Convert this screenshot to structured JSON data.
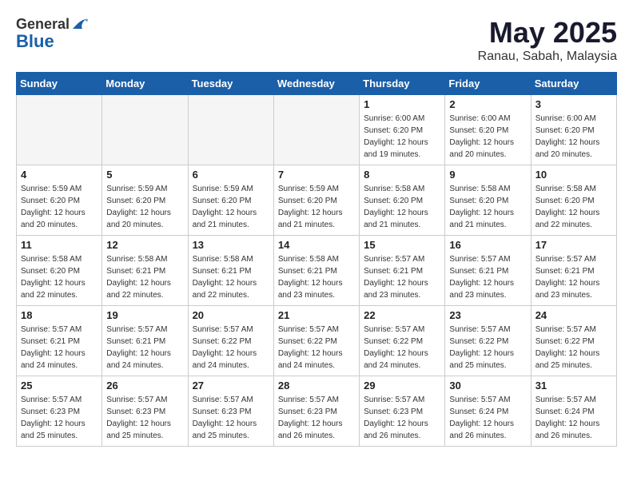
{
  "logo": {
    "general": "General",
    "blue": "Blue"
  },
  "header": {
    "month": "May 2025",
    "location": "Ranau, Sabah, Malaysia"
  },
  "weekdays": [
    "Sunday",
    "Monday",
    "Tuesday",
    "Wednesday",
    "Thursday",
    "Friday",
    "Saturday"
  ],
  "weeks": [
    [
      {
        "day": "",
        "info": ""
      },
      {
        "day": "",
        "info": ""
      },
      {
        "day": "",
        "info": ""
      },
      {
        "day": "",
        "info": ""
      },
      {
        "day": "1",
        "info": "Sunrise: 6:00 AM\nSunset: 6:20 PM\nDaylight: 12 hours\nand 19 minutes."
      },
      {
        "day": "2",
        "info": "Sunrise: 6:00 AM\nSunset: 6:20 PM\nDaylight: 12 hours\nand 20 minutes."
      },
      {
        "day": "3",
        "info": "Sunrise: 6:00 AM\nSunset: 6:20 PM\nDaylight: 12 hours\nand 20 minutes."
      }
    ],
    [
      {
        "day": "4",
        "info": "Sunrise: 5:59 AM\nSunset: 6:20 PM\nDaylight: 12 hours\nand 20 minutes."
      },
      {
        "day": "5",
        "info": "Sunrise: 5:59 AM\nSunset: 6:20 PM\nDaylight: 12 hours\nand 20 minutes."
      },
      {
        "day": "6",
        "info": "Sunrise: 5:59 AM\nSunset: 6:20 PM\nDaylight: 12 hours\nand 21 minutes."
      },
      {
        "day": "7",
        "info": "Sunrise: 5:59 AM\nSunset: 6:20 PM\nDaylight: 12 hours\nand 21 minutes."
      },
      {
        "day": "8",
        "info": "Sunrise: 5:58 AM\nSunset: 6:20 PM\nDaylight: 12 hours\nand 21 minutes."
      },
      {
        "day": "9",
        "info": "Sunrise: 5:58 AM\nSunset: 6:20 PM\nDaylight: 12 hours\nand 21 minutes."
      },
      {
        "day": "10",
        "info": "Sunrise: 5:58 AM\nSunset: 6:20 PM\nDaylight: 12 hours\nand 22 minutes."
      }
    ],
    [
      {
        "day": "11",
        "info": "Sunrise: 5:58 AM\nSunset: 6:20 PM\nDaylight: 12 hours\nand 22 minutes."
      },
      {
        "day": "12",
        "info": "Sunrise: 5:58 AM\nSunset: 6:21 PM\nDaylight: 12 hours\nand 22 minutes."
      },
      {
        "day": "13",
        "info": "Sunrise: 5:58 AM\nSunset: 6:21 PM\nDaylight: 12 hours\nand 22 minutes."
      },
      {
        "day": "14",
        "info": "Sunrise: 5:58 AM\nSunset: 6:21 PM\nDaylight: 12 hours\nand 23 minutes."
      },
      {
        "day": "15",
        "info": "Sunrise: 5:57 AM\nSunset: 6:21 PM\nDaylight: 12 hours\nand 23 minutes."
      },
      {
        "day": "16",
        "info": "Sunrise: 5:57 AM\nSunset: 6:21 PM\nDaylight: 12 hours\nand 23 minutes."
      },
      {
        "day": "17",
        "info": "Sunrise: 5:57 AM\nSunset: 6:21 PM\nDaylight: 12 hours\nand 23 minutes."
      }
    ],
    [
      {
        "day": "18",
        "info": "Sunrise: 5:57 AM\nSunset: 6:21 PM\nDaylight: 12 hours\nand 24 minutes."
      },
      {
        "day": "19",
        "info": "Sunrise: 5:57 AM\nSunset: 6:21 PM\nDaylight: 12 hours\nand 24 minutes."
      },
      {
        "day": "20",
        "info": "Sunrise: 5:57 AM\nSunset: 6:22 PM\nDaylight: 12 hours\nand 24 minutes."
      },
      {
        "day": "21",
        "info": "Sunrise: 5:57 AM\nSunset: 6:22 PM\nDaylight: 12 hours\nand 24 minutes."
      },
      {
        "day": "22",
        "info": "Sunrise: 5:57 AM\nSunset: 6:22 PM\nDaylight: 12 hours\nand 24 minutes."
      },
      {
        "day": "23",
        "info": "Sunrise: 5:57 AM\nSunset: 6:22 PM\nDaylight: 12 hours\nand 25 minutes."
      },
      {
        "day": "24",
        "info": "Sunrise: 5:57 AM\nSunset: 6:22 PM\nDaylight: 12 hours\nand 25 minutes."
      }
    ],
    [
      {
        "day": "25",
        "info": "Sunrise: 5:57 AM\nSunset: 6:23 PM\nDaylight: 12 hours\nand 25 minutes."
      },
      {
        "day": "26",
        "info": "Sunrise: 5:57 AM\nSunset: 6:23 PM\nDaylight: 12 hours\nand 25 minutes."
      },
      {
        "day": "27",
        "info": "Sunrise: 5:57 AM\nSunset: 6:23 PM\nDaylight: 12 hours\nand 25 minutes."
      },
      {
        "day": "28",
        "info": "Sunrise: 5:57 AM\nSunset: 6:23 PM\nDaylight: 12 hours\nand 26 minutes."
      },
      {
        "day": "29",
        "info": "Sunrise: 5:57 AM\nSunset: 6:23 PM\nDaylight: 12 hours\nand 26 minutes."
      },
      {
        "day": "30",
        "info": "Sunrise: 5:57 AM\nSunset: 6:24 PM\nDaylight: 12 hours\nand 26 minutes."
      },
      {
        "day": "31",
        "info": "Sunrise: 5:57 AM\nSunset: 6:24 PM\nDaylight: 12 hours\nand 26 minutes."
      }
    ]
  ]
}
